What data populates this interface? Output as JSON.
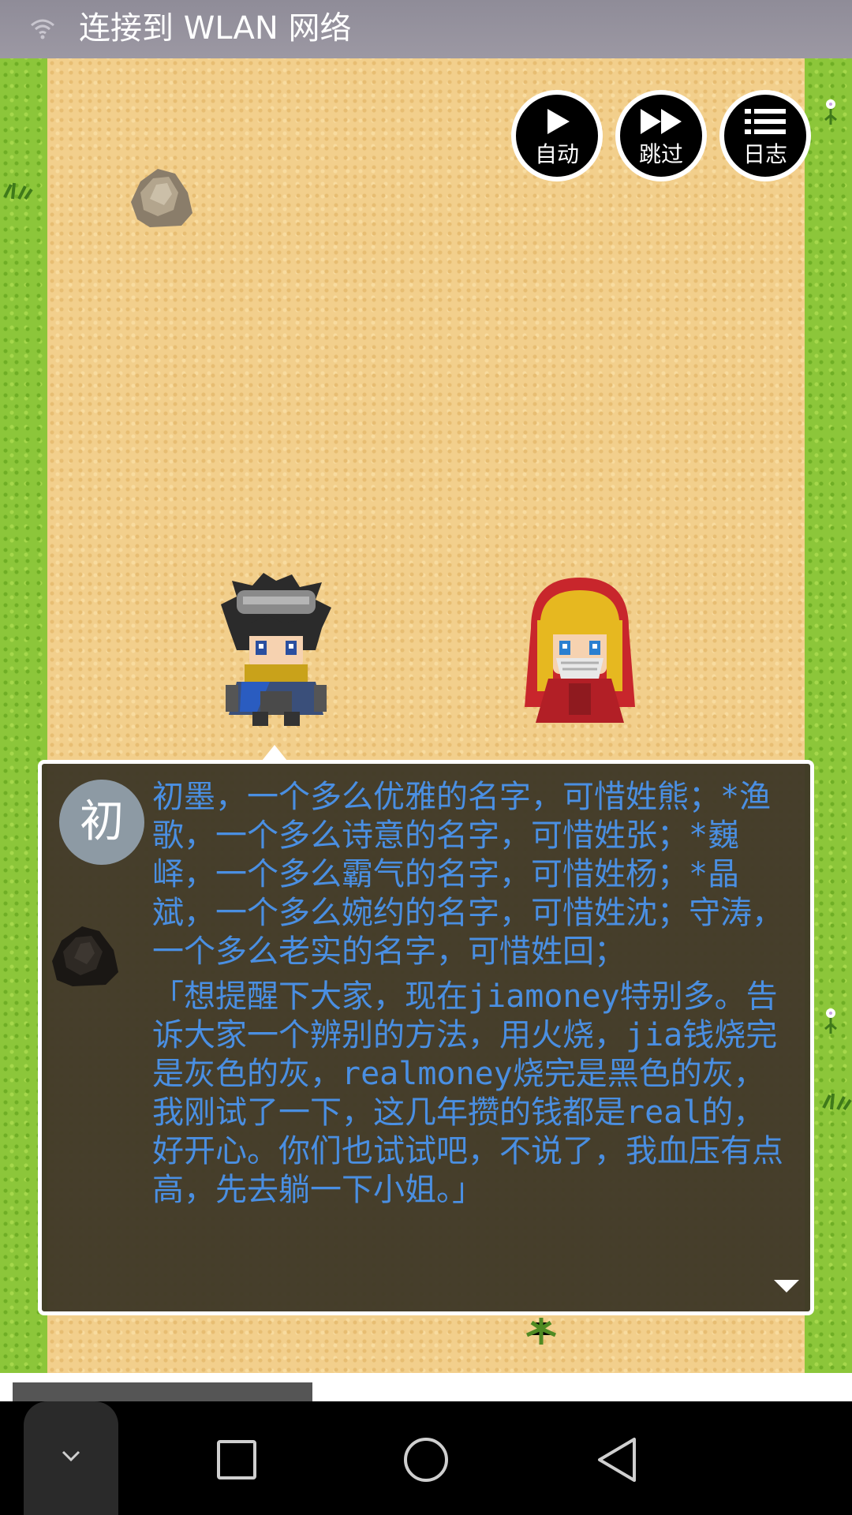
{
  "status_bar": {
    "text": "连接到 WLAN 网络",
    "wifi_icon": "wifi-question-icon"
  },
  "menu": {
    "auto_label": "自动",
    "skip_label": "跳过",
    "log_label": "日志"
  },
  "dialog": {
    "speaker_initial": "初",
    "paragraph1": "初墨，一个多么优雅的名字，可惜姓熊；*渔歌，一个多么诗意的名字，可惜姓张；*巍峄，一个多么霸气的名字，可惜姓杨；*晶斌，一个多么婉约的名字，可惜姓沈；守涛，一个多么老实的名字，可惜姓回；",
    "paragraph2": "「想提醒下大家，现在jiamoney特别多。告诉大家一个辨别的方法，用火烧，jia钱烧完是灰色的灰，realmoney烧完是黑色的灰，我刚试了一下，这几年攒的钱都是real的，好开心。你们也试试吧，不说了，我血压有点高，先去躺一下小姐。」",
    "text_color": "#4a8fe2"
  },
  "colors": {
    "grass": "#8cc63a",
    "sand": "#f2cf8c",
    "dialog_bg": "#3e3826"
  },
  "nav": {
    "collapse_icon": "chevron-down-icon",
    "recent_icon": "square-icon",
    "home_icon": "circle-icon",
    "back_icon": "triangle-back-icon"
  }
}
